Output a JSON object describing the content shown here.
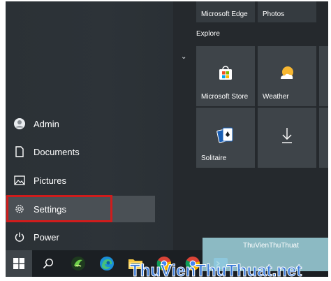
{
  "rail": {
    "items": [
      {
        "label": "Admin",
        "icon": "user-avatar-icon"
      },
      {
        "label": "Documents",
        "icon": "document-icon"
      },
      {
        "label": "Pictures",
        "icon": "picture-icon"
      },
      {
        "label": "Settings",
        "icon": "gear-icon",
        "selected": true
      },
      {
        "label": "Power",
        "icon": "power-icon"
      }
    ]
  },
  "tiles": {
    "top_labels": [
      "Microsoft Edge",
      "Photos"
    ],
    "section": "Explore",
    "items": [
      {
        "label": "Microsoft Store",
        "icon": "store-icon"
      },
      {
        "label": "Weather",
        "icon": "weather-icon"
      },
      {
        "label": "Solitaire",
        "icon": "solitaire-icon"
      },
      {
        "label": "",
        "icon": "download-icon"
      }
    ]
  },
  "taskbar": {
    "icons": [
      "windows-start-icon",
      "search-icon",
      "app-icon",
      "edge-icon",
      "file-explorer-icon",
      "chrome-icon",
      "chrome-icon",
      "terminal-icon"
    ]
  },
  "watermark": {
    "small": "ThuVienThuThuat",
    "big": "ThuVienThuThuat.net"
  },
  "colors": {
    "highlight_border": "#d01c1c",
    "watermark_text": "#3b7bd9"
  }
}
